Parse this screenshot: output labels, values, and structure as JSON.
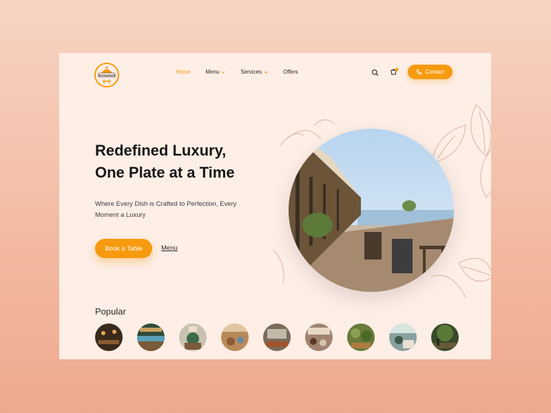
{
  "brand": {
    "logo_text": "RESTAURANT"
  },
  "nav": {
    "items": [
      {
        "label": "Home",
        "active": true,
        "has_dropdown": false
      },
      {
        "label": "Menu",
        "active": false,
        "has_dropdown": true
      },
      {
        "label": "Services",
        "active": false,
        "has_dropdown": true
      },
      {
        "label": "Offers",
        "active": false,
        "has_dropdown": false
      }
    ]
  },
  "header": {
    "contact_label": "Contact",
    "cart_badge_icon": "cart-icon",
    "search_icon": "search-icon"
  },
  "hero": {
    "title_line1": "Redefined Luxury,",
    "title_line2": "One Plate at a Time",
    "subtitle": "Where Every Dish is Crafted to Perfection, Every Moment a Luxury",
    "cta_label": "Book a Table",
    "secondary_label": "Menu"
  },
  "popular": {
    "title": "Popular",
    "count": 9
  },
  "colors": {
    "accent": "#f79a0f",
    "card_bg": "#fdeee6",
    "text_dark": "#161616"
  }
}
